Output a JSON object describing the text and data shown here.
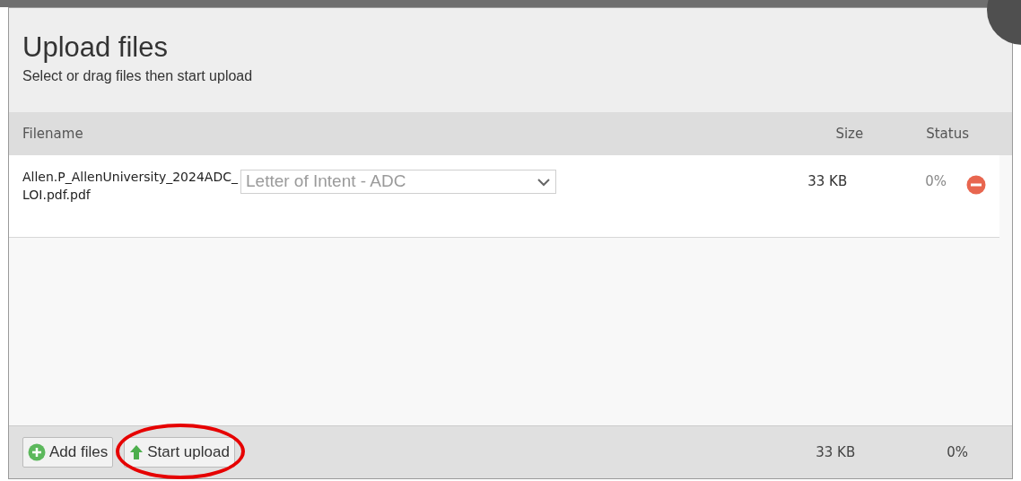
{
  "dialog": {
    "title": "Upload files",
    "subtitle": "Select or drag files then start upload"
  },
  "table": {
    "columns": [
      "Filename",
      "Size",
      "Status"
    ],
    "rows": [
      {
        "filename": "Allen.P_AllenUniversity_2024ADC_LOI.pdf.pdf",
        "document_type": "Letter of Intent - ADC",
        "size": "33 KB",
        "status": "0%"
      }
    ]
  },
  "footer": {
    "buttons": [
      {
        "label": "Add files",
        "kind": "add"
      },
      {
        "label": "Start upload",
        "kind": "upload",
        "highlighted": true
      }
    ],
    "total_size": "33 KB",
    "total_status": "0%"
  }
}
